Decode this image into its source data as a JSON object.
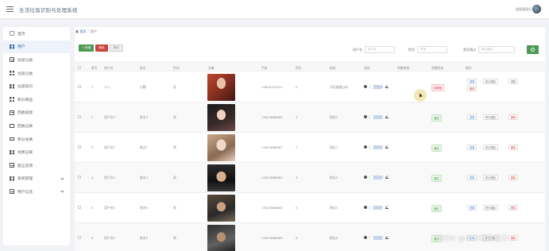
{
  "app": {
    "title": "生活垃圾识别与处理系统",
    "user_label": "超级管理员"
  },
  "sidebar": {
    "items": [
      {
        "label": "首页",
        "icon": "home-icon"
      },
      {
        "label": "用户",
        "icon": "grid-icon",
        "active": true
      },
      {
        "label": "垃圾分类",
        "icon": "doc-icon"
      },
      {
        "label": "垃圾分类",
        "icon": "grid-icon"
      },
      {
        "label": "垃圾知识",
        "icon": "grid-icon"
      },
      {
        "label": "积分商品",
        "icon": "grid-icon"
      },
      {
        "label": "回收投放",
        "icon": "doc-icon"
      },
      {
        "label": "回收记录",
        "icon": "monitor-icon"
      },
      {
        "label": "积分兑换",
        "icon": "monitor-icon"
      },
      {
        "label": "兑换记录",
        "icon": "grid-icon"
      },
      {
        "label": "留言反馈",
        "icon": "doc-icon"
      },
      {
        "label": "系统管理",
        "icon": "grid-icon",
        "expandable": true
      },
      {
        "label": "用户信息",
        "icon": "doc-icon",
        "expandable": true
      }
    ]
  },
  "breadcrumb": {
    "home": "首页",
    "current": "用户"
  },
  "toolbar": {
    "add": "+ 新增",
    "delete": "删除",
    "export": "导出"
  },
  "filters": {
    "username_label": "用户名",
    "username_placeholder": "用户名",
    "gender_label": "性别",
    "gender_placeholder": "性别",
    "status_label": "是否通过",
    "status_placeholder": "是否通过"
  },
  "table": {
    "columns": [
      "索引",
      "用户名",
      "姓名",
      "性别",
      "头像",
      "手机",
      "积分",
      "地址",
      "状态",
      "余额审核",
      "余额状态",
      "操作"
    ],
    "rows": [
      {
        "index": "1",
        "username": "111",
        "name": "小鹏",
        "gender": "女",
        "phone": "13625252121",
        "points": "0",
        "address": "河北省唐山市",
        "audit_status": "待审核",
        "audit_type": "warn",
        "photo": "p1"
      },
      {
        "index": "2",
        "username": "用户名3",
        "name": "姓名3",
        "gender": "男",
        "phone": "13823888883",
        "points": "3",
        "address": "地址3",
        "audit_status": "通过",
        "audit_type": "ok",
        "photo": "p2"
      },
      {
        "index": "3",
        "username": "用户名7",
        "name": "姓名7",
        "gender": "男",
        "phone": "13823888887",
        "points": "7",
        "address": "地址7",
        "audit_status": "通过",
        "audit_type": "ok",
        "photo": "p3"
      },
      {
        "index": "4",
        "username": "用户名3",
        "name": "姓名3",
        "gender": "男",
        "phone": "13823888883",
        "points": "3",
        "address": "地址3",
        "audit_status": "通过",
        "audit_type": "ok",
        "photo": "p4"
      },
      {
        "index": "5",
        "username": "用户名5",
        "name": "姓名5",
        "gender": "男",
        "phone": "13823888885",
        "points": "5",
        "address": "地址5",
        "audit_status": "通过",
        "audit_type": "ok",
        "photo": "p5"
      },
      {
        "index": "6",
        "username": "用户名9",
        "name": "姓名9",
        "gender": "男",
        "phone": "13823888889",
        "points": "9",
        "address": "地址9",
        "audit_status": "通过",
        "audit_type": "ok",
        "photo": "p6"
      }
    ],
    "actions": {
      "view": "查看",
      "points": "积分奖励",
      "review": "审核",
      "delete": "删除"
    }
  },
  "watermark": "CSDN @小小程序设计"
}
